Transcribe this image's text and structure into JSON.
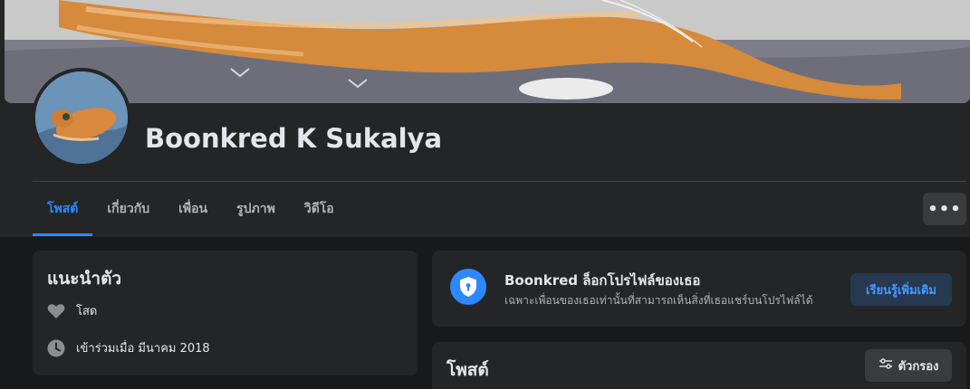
{
  "profile": {
    "name": "Boonkred K Sukalya"
  },
  "tabs": [
    {
      "label": "โพสต์",
      "active": true
    },
    {
      "label": "เกี่ยวกับ",
      "active": false
    },
    {
      "label": "เพื่อน",
      "active": false
    },
    {
      "label": "รูปภาพ",
      "active": false
    },
    {
      "label": "วิดีโอ",
      "active": false
    }
  ],
  "more_label": "•••",
  "intro": {
    "title": "แนะนำตัว",
    "relationship": {
      "icon": "heart-icon",
      "text": "โสด"
    },
    "joined": {
      "icon": "clock-icon",
      "text": "เข้าร่วมเมื่อ มีนาคม 2018"
    }
  },
  "locked": {
    "icon": "shield-lock-icon",
    "title": "Boonkred ล็อกโปรไฟล์ของเธอ",
    "subtitle": "เฉพาะเพื่อนของเธอเท่านั้นที่สามารถเห็นสิ่งที่เธอแชร์บนโปรไฟล์ได้",
    "button_label": "เรียนรู้เพิ่มเติม"
  },
  "posts": {
    "title": "โพสต์",
    "filter_label": "ตัวกรอง",
    "filter_icon": "sliders-icon"
  },
  "colors": {
    "background": "#18191a",
    "card": "#242526",
    "accent": "#2d88ff",
    "text": "#e4e6eb",
    "secondary_text": "#b0b3b8"
  }
}
